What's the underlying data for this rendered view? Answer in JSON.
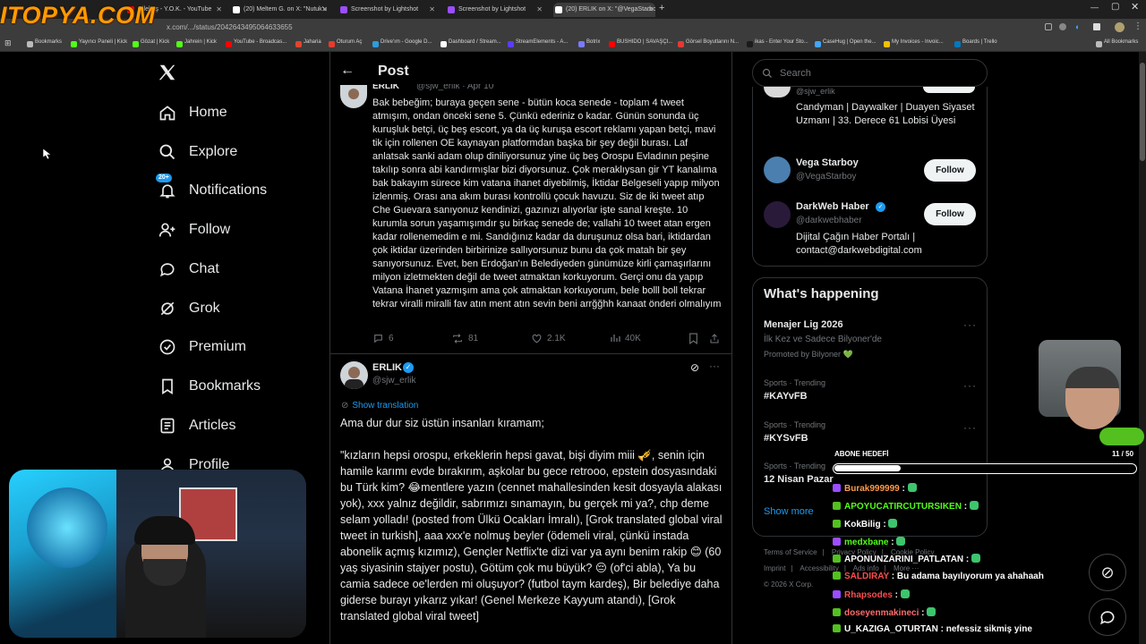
{
  "browser": {
    "tabs": [
      {
        "label": "Çilekeş - Y.O.K. - YouTube",
        "color": "#ff0000"
      },
      {
        "label": "(20) Meltem G. on X: \"Nutuk'u",
        "color": "#ffffff"
      },
      {
        "label": "Screenshot by Lightshot",
        "color": "#9b4dff"
      },
      {
        "label": "Screenshot by Lightshot",
        "color": "#9b4dff"
      },
      {
        "label": "(20) ERLIK on X: \"@VegaStarbo",
        "color": "#ffffff"
      }
    ],
    "new_tab_glyph": "+",
    "url": "x.com/.../status/2042643495064633655",
    "bookmarks": [
      {
        "label": "Bookmarks",
        "color": "#bbbbbb"
      },
      {
        "label": "Yayıncı Paneli | Kick",
        "color": "#53fc18"
      },
      {
        "label": "Gözat | Kick",
        "color": "#53fc18"
      },
      {
        "label": "Jahrein | Kick",
        "color": "#53fc18"
      },
      {
        "label": "YouTube - Broadcas...",
        "color": "#ff0000"
      },
      {
        "label": "Jaharia",
        "color": "#e0452b"
      },
      {
        "label": "Oturum Aç",
        "color": "#e63b2e"
      },
      {
        "label": "Drive'ım - Google D...",
        "color": "#2d9cdb"
      },
      {
        "label": "Dashboard / Stream...",
        "color": "#ffffff"
      },
      {
        "label": "StreamElements - A...",
        "color": "#5b3bff"
      },
      {
        "label": "Botrix",
        "color": "#7a7aff"
      },
      {
        "label": "BUSHIDO | SAVAŞÇI...",
        "color": "#ff0000"
      },
      {
        "label": "Görsel Boyutlarını N...",
        "color": "#e53935"
      },
      {
        "label": "ikas - Enter Your Sto...",
        "color": "#1b1b1b"
      },
      {
        "label": "CaseHug | Open the...",
        "color": "#3fa7ff"
      },
      {
        "label": "My Invoices - Invoic...",
        "color": "#f2c200"
      },
      {
        "label": "Boards | Trello",
        "color": "#0079bf"
      },
      {
        "label": "All Bookmarks",
        "color": "#bbbbbb"
      }
    ]
  },
  "overlay": {
    "site_logo": "ITOPYA.COM",
    "goal_label": "ABONE HEDEFİ",
    "goal_count": "11 / 50",
    "goal_progress": 0.22
  },
  "sidebar": {
    "items": [
      {
        "label": "Home",
        "icon": "home-icon"
      },
      {
        "label": "Explore",
        "icon": "search-icon"
      },
      {
        "label": "Notifications",
        "icon": "bell-icon",
        "badge": "20+"
      },
      {
        "label": "Follow",
        "icon": "add-person-icon"
      },
      {
        "label": "Chat",
        "icon": "chat-icon"
      },
      {
        "label": "Grok",
        "icon": "grok-icon"
      },
      {
        "label": "Premium",
        "icon": "verified-icon"
      },
      {
        "label": "Bookmarks",
        "icon": "bookmark-icon"
      },
      {
        "label": "Articles",
        "icon": "article-icon"
      },
      {
        "label": "Profile",
        "icon": "person-icon"
      }
    ]
  },
  "header": {
    "title": "Post"
  },
  "tweet1": {
    "author_fragment": "ERLIK",
    "handle_fragment": "@sjw_erlik · Apr 10",
    "text": "Bak bebeğim; buraya geçen sene - bütün koca senede - toplam 4 tweet atmışım, ondan önceki sene 5. Çünkü ederiniz o kadar. Günün sonunda üç kuruşluk betçi, üç beş escort, ya da üç kuruşa escort reklamı yapan betçi, mavi tik için rollenen OE kaynayan platformdan başka bir şey değil burası. Laf anlatsak sanki adam olup diniliyorsunuz yine üç beş Orospu Evladının peşine takılıp sonra abi kandırmışlar bizi diyorsunuz. Çok meraklıysan gir YT kanalıma bak bakayım sürece kim vatana ihanet diyebilmiş, İktidar Belgeseli yapıp milyon izlenmiş. Orası ana akım burası kontrollü çocuk havuzu. Siz de iki tweet atıp Che Guevara sanıyonuz kendinizi, gazınızı alıyorlar işte sanal kreşte. 10 kurumla sorun yaşamışımdır şu birkaç senede de; vallahi 10 tweet atan ergen kadar rollenemedim e mi. Sandığınız kadar da duruşunuz olsa bari, iktidardan çok iktidar üzerinden birbirinize sallıyorsunuz bunu da çok matah bir şey sanıyorsunuz. Evet, ben Erdoğan'ın Belediyeden günümüze kirli çamaşırlarını milyon izletmekten değil de tweet atmaktan korkuyorum. Gerçi onu da yapıp Vatana İhanet yazmışım ama çok atmaktan korkuyorum, bele bolll boll tekrar tekrar viralli miralli fav atın ment atın sevin beni arrğğhh kanaat önderi olmalıyım",
    "replies": "6",
    "reposts": "81",
    "likes": "2.1K",
    "views": "40K"
  },
  "tweet2": {
    "author": "ERLIK",
    "handle": "@sjw_erlik",
    "show_translation": "Show translation",
    "line1": "Ama dur dur siz üstün insanları kıramam;",
    "body": "\"kızların hepsi orospu, erkeklerin hepsi gavat, bişi diyim miii 🎺, senin için hamile karımı evde bırakırım, aşkolar bu gece retrooo, epstein dosyasındaki bu Türk kim? 😂mentlere yazın (cennet mahallesinden kesit dosyayla alakası yok), xxx yalnız değildir, sabrımızı sınamayın, bu gerçek mi ya?, chp deme selam yolladı! (posted from Ülkü Ocakları İmralı), [Grok translated global viral tweet in turkish], aaa xxx'e nolmuş beyler (ödemeli viral, çünkü instada abonelik açmış kızımız), Gençler Netflix'te dizi var ya aynı benim rakip 😊 (60 yaş siyasinin stajyer postu), Götüm çok mu büyük? 😔 (of'ci abla), Ya bu camia sadece oe'lerden mi oluşuyor? (futbol taym kardeş), Bir belediye daha giderse burayı yıkarız yıkar! (Genel Merkeze Kayyum atandı), [Grok translated global viral tweet]"
  },
  "right": {
    "search_placeholder": "Search",
    "follow_label": "Follow",
    "who_to_follow": [
      {
        "name": "",
        "handle": "@sjw_erlik",
        "bio": "Candyman | Daywalker | Duayen Siyaset Uzmanı | 33. Derece 61 Lobisi Üyesi",
        "avatar_color": "#d9d9d9"
      },
      {
        "name": "Vega Starboy",
        "handle": "@VegaStarboy",
        "bio": "",
        "avatar_color": "#4a7fb0"
      },
      {
        "name": "DarkWeb Haber",
        "handle": "@darkwebhaber",
        "bio": "Dijital Çağın Haber Portalı | contact@darkwebdigital.com",
        "avatar_color": "#2a1a3a"
      }
    ],
    "whats_happening_title": "What's happening",
    "promo": {
      "title": "Menajer Lig 2026",
      "subtitle": "İlk Kez ve Sadece Bilyoner'de",
      "promoted": "Promoted by Bilyoner 💚"
    },
    "trends": [
      {
        "category": "Sports · Trending",
        "name": "#KAYvFB"
      },
      {
        "category": "Sports · Trending",
        "name": "#KYSvFB"
      },
      {
        "category": "Sports · Trending",
        "name": "12 Nisan Pazar"
      }
    ],
    "show_more": "Show more",
    "footer": {
      "links": [
        "Terms of Service",
        "Privacy Policy",
        "Cookie Policy",
        "Imprint",
        "Accessibility",
        "Ads info",
        "More ···"
      ],
      "copyright": "© 2026 X Corp."
    }
  },
  "chat": [
    {
      "user": "Burak999999",
      "msg": "",
      "color": "#ff9a4a"
    },
    {
      "user": "APOYUCATIRCUTURSIKEN",
      "msg": "",
      "color": "#53fc18"
    },
    {
      "user": "KokBilig",
      "msg": "",
      "color": "#ffffff"
    },
    {
      "user": "medxbane",
      "msg": "",
      "color": "#53fc18"
    },
    {
      "user": "APONUNZARINI_PATLATAN",
      "msg": "",
      "color": "#ffffff"
    },
    {
      "user": "SALDIRAY",
      "msg": "Bu adama bayılıyorum ya ahahaah",
      "color": "#ff4d4d"
    },
    {
      "user": "Rhapsodes",
      "msg": "",
      "color": "#ff4d4d"
    },
    {
      "user": "doseyenmakineci",
      "msg": "",
      "color": "#ff6b6b"
    },
    {
      "user": "U_KAZIGA_OTURTAN",
      "msg": "nefessiz sikmiş yine",
      "color": "#ffffff"
    }
  ]
}
